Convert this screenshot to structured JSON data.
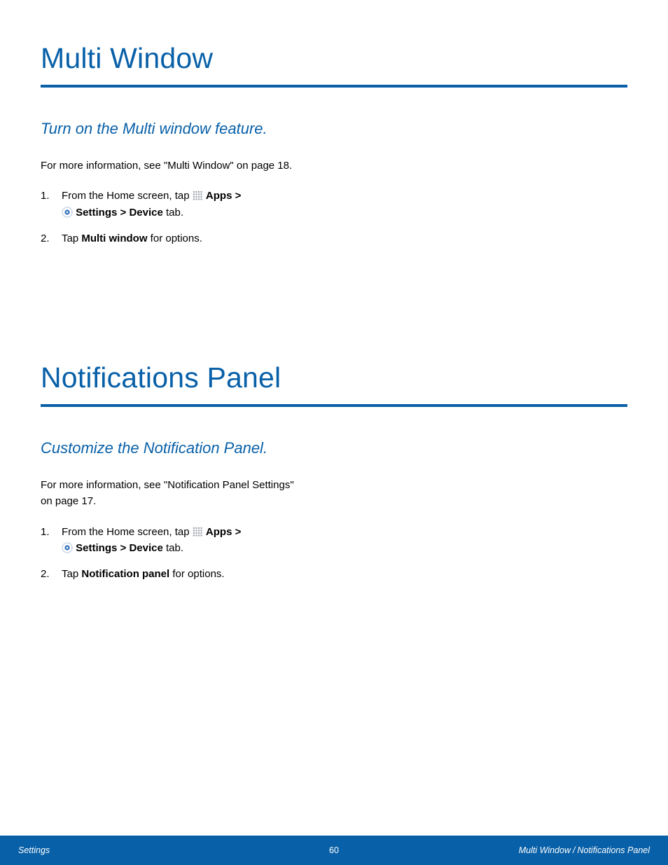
{
  "sections": [
    {
      "title": "Multi Window",
      "subheading": "Turn on the Multi window feature.",
      "intro_a": "For more information, see \"Multi Window\" on page 18.",
      "step1_pre": "From the Home screen, tap ",
      "step1_apps": "Apps",
      "step1_gt": " > ",
      "step1_settings": "Settings",
      "step1_gt2": " > ",
      "step1_device": "Device",
      "step1_tab": " tab.",
      "step2_pre": "Tap ",
      "step2_bold": "Multi window",
      "step2_post": " for options."
    },
    {
      "title": "Notifications Panel",
      "subheading": "Customize the Notification Panel.",
      "intro_a": "For more information, see \"Notification Panel Settings\" on page 17.",
      "step1_pre": "From the Home screen, tap ",
      "step1_apps": "Apps",
      "step1_gt": " > ",
      "step1_settings": "Settings",
      "step1_gt2": " > ",
      "step1_device": "Device",
      "step1_tab": " tab.",
      "step2_pre": "Tap ",
      "step2_bold": "Notification panel",
      "step2_post": " for options."
    }
  ],
  "footer": {
    "left": "Settings",
    "center": "60",
    "right_a": "Multi Window",
    "right_sep": "/",
    "right_b": "Notifications Panel"
  }
}
